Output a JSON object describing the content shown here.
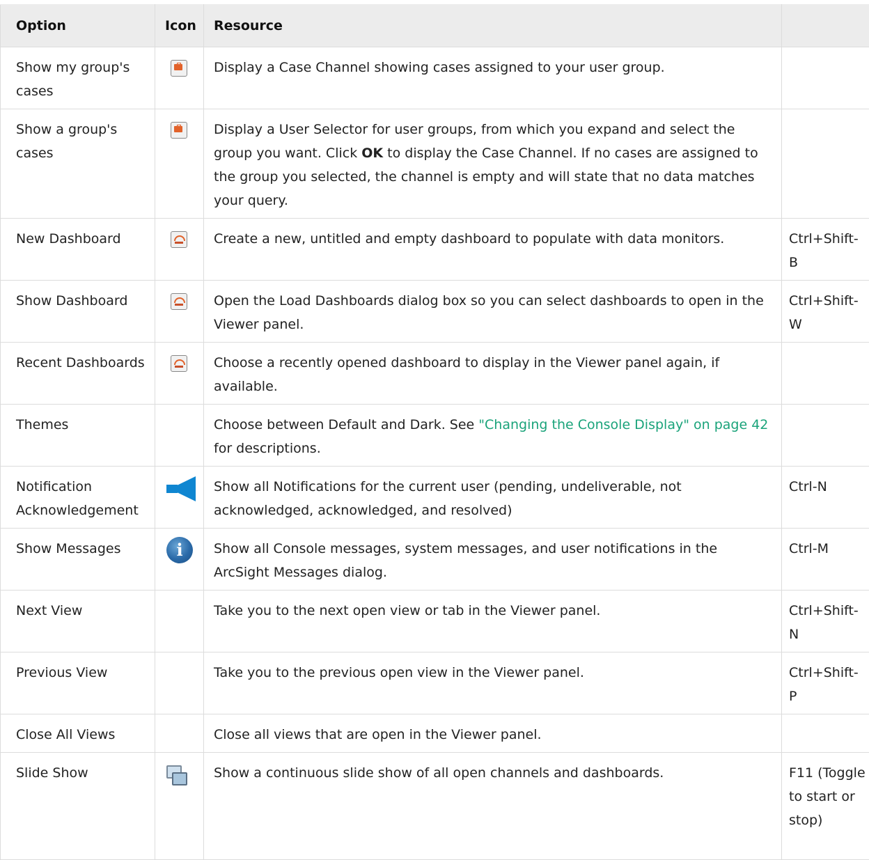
{
  "header": {
    "option": "Option",
    "icon": "Icon",
    "resource": "Resource"
  },
  "rows": [
    {
      "option": "Show my group's cases",
      "icon": "case-folder-icon",
      "resource": "Display a Case Channel showing cases assigned to your user group.",
      "shortcut": ""
    },
    {
      "option": "Show a group's cases",
      "icon": "case-folder-icon",
      "resource_a": "Display a User Selector for user groups, from which you expand and select the group you want. Click ",
      "resource_bold": "OK",
      "resource_b": " to display the Case Channel. If no cases are assigned to the group you selected, the channel is empty and will state that no data matches your query.",
      "shortcut": ""
    },
    {
      "option": "New Dashboard",
      "icon": "dashboard-icon",
      "resource": "Create a new, untitled and empty dashboard to populate with data monitors.",
      "shortcut": "Ctrl+Shift-B"
    },
    {
      "option": "Show Dashboard",
      "icon": "dashboard-icon",
      "resource": "Open the Load Dashboards dialog box so you can select dashboards to open in the Viewer panel.",
      "shortcut": "Ctrl+Shift-W"
    },
    {
      "option": "Recent Dashboards",
      "icon": "dashboard-icon",
      "resource": "Choose a recently opened dashboard to display in the Viewer panel again, if available.",
      "shortcut": ""
    },
    {
      "option": "Themes",
      "icon": "",
      "resource_a": "Choose between Default and Dark. See ",
      "resource_link": "\"Changing the Console Display\" on page 42",
      "resource_b": " for descriptions.",
      "shortcut": ""
    },
    {
      "option": "Notification Acknowledgement",
      "icon": "megaphone-icon",
      "resource": "Show all Notifications for the current user (pending, undeliverable, not acknowledged, acknowledged, and resolved)",
      "shortcut": "Ctrl-N"
    },
    {
      "option": "Show Messages",
      "icon": "info-icon",
      "resource": "Show all Console messages, system messages, and user notifications in the ArcSight Messages dialog.",
      "shortcut": "Ctrl-M"
    },
    {
      "option": "Next View",
      "icon": "",
      "resource": "Take you to the next open view or tab in the Viewer panel.",
      "shortcut": "Ctrl+Shift-N"
    },
    {
      "option": "Previous View",
      "icon": "",
      "resource": "Take you to the previous open view in the Viewer panel.",
      "shortcut": "Ctrl+Shift-P"
    },
    {
      "option": "Close All Views",
      "icon": "",
      "resource": "Close all views that are open in the Viewer panel.",
      "shortcut": ""
    },
    {
      "option": "Slide Show",
      "icon": "slide-show-icon",
      "resource": "Show a continuous slide show of all open channels and dashboards.",
      "shortcut": "F11 (Toggle to start or stop)"
    }
  ],
  "colors": {
    "link": "#1aa37a",
    "header_bg": "#ececec",
    "border": "#dcdcdc"
  }
}
